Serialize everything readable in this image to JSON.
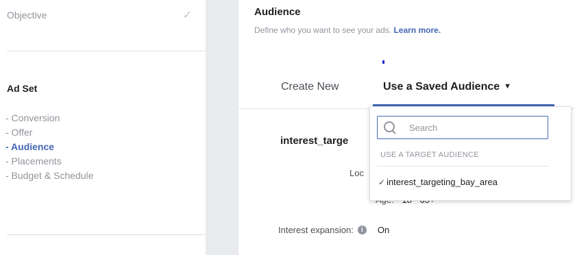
{
  "left_nav": {
    "objective_label": "Objective",
    "objective_check": "✓",
    "section_title": "Ad Set",
    "steps": [
      {
        "label": "- Conversion"
      },
      {
        "label": "- Offer"
      },
      {
        "label": "- Audience"
      },
      {
        "label": "- Placements"
      },
      {
        "label": "- Budget & Schedule"
      }
    ]
  },
  "audience": {
    "title": "Audience",
    "description": "Define who you want to see your ads.",
    "learn_more": "Learn more.",
    "tabs": {
      "create_new": "Create New",
      "saved": "Use a Saved Audience",
      "saved_caret": "▼"
    },
    "target_name": "interest_targe",
    "location_label": "Loc",
    "age_label": "Age:",
    "age_value": "18 - 65+",
    "interest_expansion_label": "Interest expansion:",
    "interest_expansion_info": "i",
    "interest_expansion_value": "On"
  },
  "dropdown": {
    "search_placeholder": "Search",
    "section_header": "USE A TARGET AUDIENCE",
    "item_check": "✓",
    "items": [
      {
        "label": "interest_targeting_bay_area"
      }
    ]
  },
  "colors": {
    "accent": "#4267b2",
    "muted_text": "#90949c",
    "gutter": "#e9ebee"
  }
}
